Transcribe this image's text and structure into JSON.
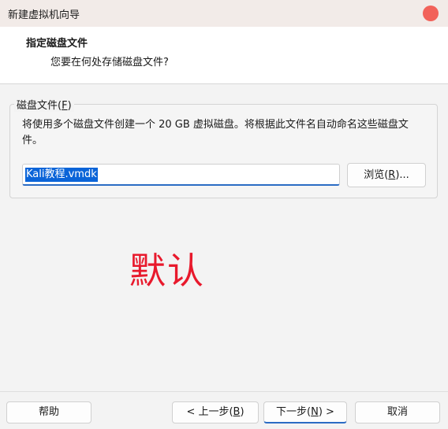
{
  "window": {
    "title": "新建虚拟机向导"
  },
  "header": {
    "title": "指定磁盘文件",
    "subtitle": "您要在何处存储磁盘文件?"
  },
  "disk_file_group": {
    "legend_text": "磁盘文件(",
    "legend_mnemonic": "F",
    "legend_suffix": ")",
    "description": "将使用多个磁盘文件创建一个 20 GB 虚拟磁盘。将根据此文件名自动命名这些磁盘文件。",
    "file_name_value": "Kali教程.vmdk",
    "browse_label_prefix": "浏览(",
    "browse_mnemonic": "R",
    "browse_label_suffix": ")..."
  },
  "annotation": {
    "text": "默认",
    "color": "#e8192c"
  },
  "footer": {
    "help_label": "帮助",
    "back_prefix": "< 上一步(",
    "back_mnemonic": "B",
    "back_suffix": ")",
    "next_prefix": "下一步(",
    "next_mnemonic": "N",
    "next_suffix": ") >",
    "cancel_label": "取消"
  },
  "colors": {
    "close_button": "#f2625a",
    "accent": "#2b6cc4",
    "selection": "#0a64d8"
  }
}
